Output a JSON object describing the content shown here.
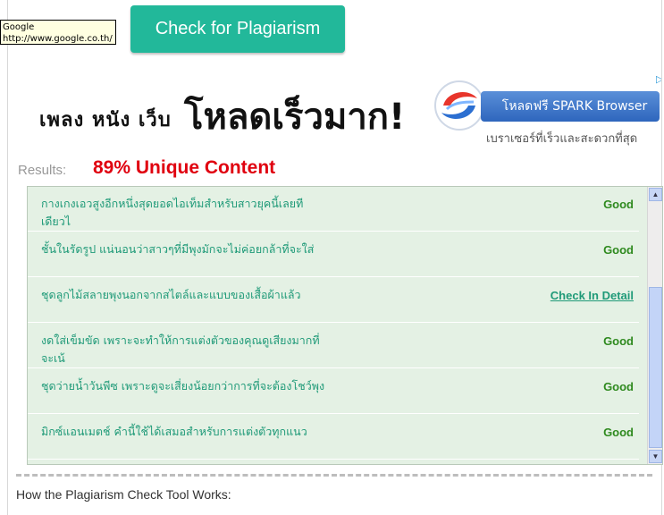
{
  "tooltip": {
    "line1": "Google",
    "line2": "http://www.google.co.th/"
  },
  "check_button": {
    "label": "Check for Plagiarism"
  },
  "ad": {
    "headline_small": "เพลง หนัง เว็บ",
    "headline_big": "โหลดเร็วมาก!",
    "button": "โหลดฟรี SPARK Browser",
    "subtext": "เบราเซอร์ที่เร็วและสะดวกที่สุด",
    "choices_glyph": "▷"
  },
  "results": {
    "label": "Results:",
    "value": "89% Unique Content"
  },
  "rows": [
    {
      "text": "กางเกงเอวสูงอีกหนึ่งสุดยอดไอเท็มสำหรับสาวยุคนี้เลยทีเดียวไ",
      "status": "Good"
    },
    {
      "text": "ชั้นในรัดรูป แน่นอนว่าสาวๆที่มีพุงมักจะไม่ค่อยกล้าที่จะใส่",
      "status": "Good"
    },
    {
      "text": "ชุดลูกไม้สลายพุงนอกจากสไตล์และแบบของเสื้อผ้าแล้ว",
      "status": "Check In Detail"
    },
    {
      "text": "งดใส่เข็มขัด เพราะจะทำให้การแต่งตัวของคุณดูเสียงมากที่จะเน้",
      "status": "Good"
    },
    {
      "text": "ชุดว่ายน้ำวันพีซ เพราะดูจะเสี่ยงน้อยกว่าการที่จะต้องโชว์พุง",
      "status": "Good"
    },
    {
      "text": "มิกซ์แอนเมตช์ คำนี้ใช้ได้เสมอสำหรับการแต่งตัวทุกแนว",
      "status": "Good"
    }
  ],
  "scroll": {
    "up_glyph": "▲",
    "down_glyph": "▼"
  },
  "section_heading": "How the Plagiarism Check Tool Works:",
  "colors": {
    "button": "#22b89a",
    "unique": "#e0000f",
    "good": "#2f8a1f",
    "row_text": "#1f9a78"
  }
}
